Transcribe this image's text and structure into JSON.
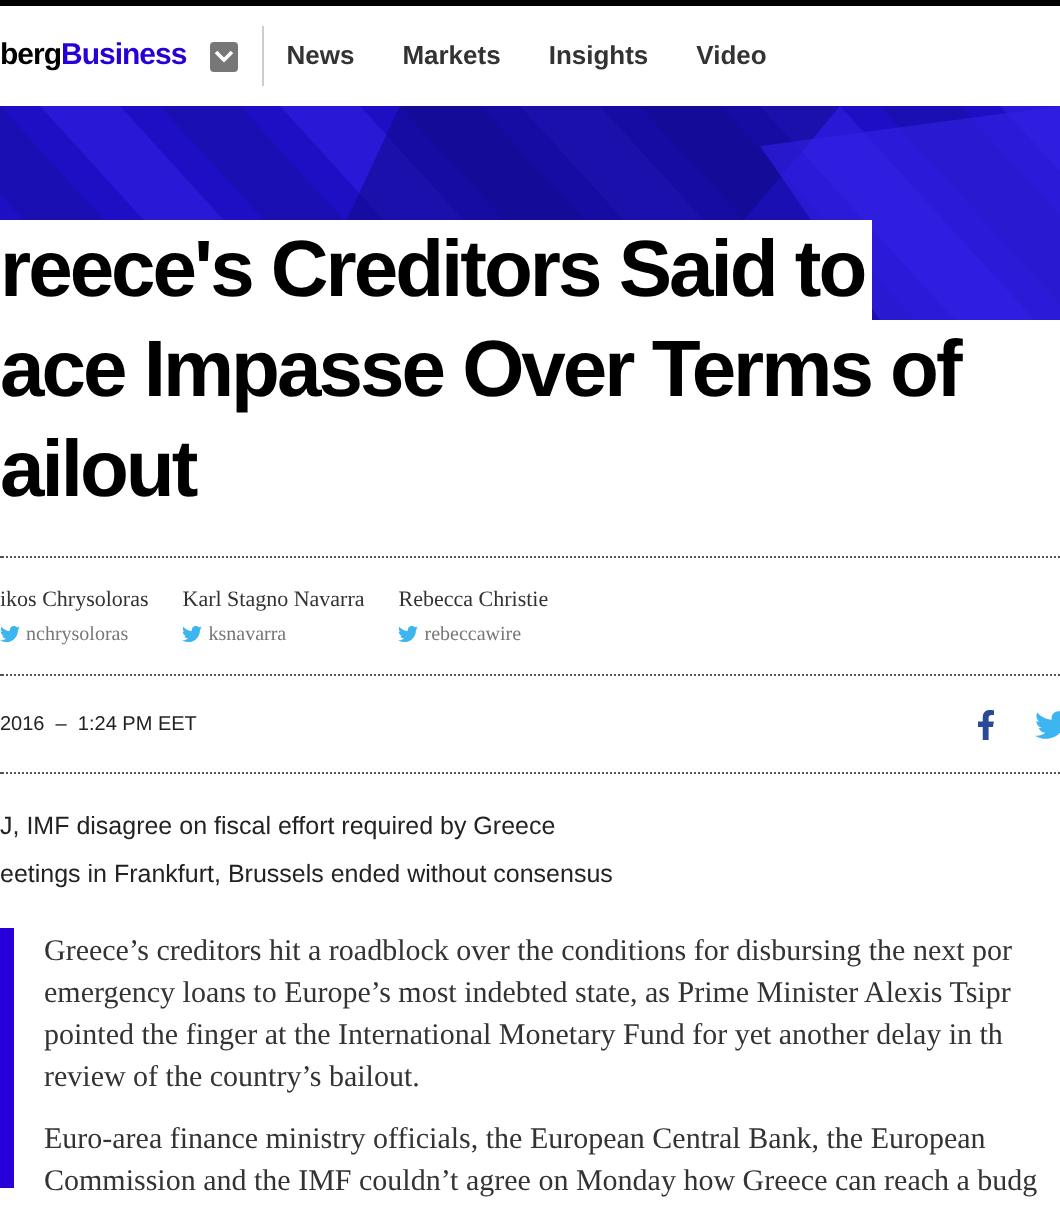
{
  "nav": {
    "logo_dark": "berg",
    "logo_brand": "Business",
    "links": [
      "News",
      "Markets",
      "Insights",
      "Video"
    ]
  },
  "headline": [
    "reece's Creditors Said to",
    "ace Impasse Over Terms of",
    "ailout"
  ],
  "authors": [
    {
      "name": "ikos Chrysoloras",
      "handle": "nchrysoloras"
    },
    {
      "name": "Karl Stagno Navarra",
      "handle": "ksnavarra"
    },
    {
      "name": "Rebecca Christie",
      "handle": "rebeccawire"
    }
  ],
  "timestamp": "2016  –  1:24 PM EET",
  "bullets": [
    "J, IMF disagree on fiscal effort required by Greece",
    "eetings in Frankfurt, Brussels ended without consensus"
  ],
  "paragraphs": [
    {
      "lines": [
        "Greece’s creditors hit a roadblock over the conditions for disbursing the next por",
        "emergency loans to Europe’s most indebted state, as Prime Minister Alexis Tsipr",
        "pointed the finger at the International Monetary Fund for yet another delay in th",
        "review of the country’s bailout."
      ]
    },
    {
      "lines": [
        "Euro-area finance ministry officials, the European Central Bank, the European",
        "Commission and the IMF couldn’t agree on Monday how Greece can reach a budg"
      ]
    }
  ]
}
